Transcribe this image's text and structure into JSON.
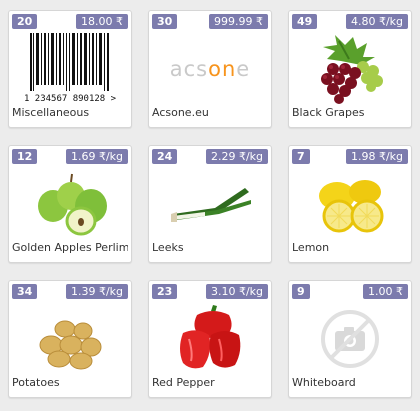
{
  "products": [
    {
      "qty": "20",
      "price": "18.00 ₹",
      "name": "Miscellaneous",
      "icon": "barcode-image"
    },
    {
      "qty": "30",
      "price": "999.99 ₹",
      "name": "Acsone.eu",
      "icon": "acsone-logo",
      "logo_text": {
        "a": "acs",
        "b": "on",
        "c": "e"
      }
    },
    {
      "qty": "49",
      "price": "4.80 ₹/kg",
      "name": "Black Grapes",
      "icon": "grapes-image"
    },
    {
      "qty": "12",
      "price": "1.69 ₹/kg",
      "name": "Golden Apples Perlim",
      "icon": "apples-image"
    },
    {
      "qty": "24",
      "price": "2.29 ₹/kg",
      "name": "Leeks",
      "icon": "leeks-image"
    },
    {
      "qty": "7",
      "price": "1.98 ₹/kg",
      "name": "Lemon",
      "icon": "lemon-image"
    },
    {
      "qty": "34",
      "price": "1.39 ₹/kg",
      "name": "Potatoes",
      "icon": "potatoes-image"
    },
    {
      "qty": "23",
      "price": "3.10 ₹/kg",
      "name": "Red Pepper",
      "icon": "red-pepper-image"
    },
    {
      "qty": "9",
      "price": "1.00 ₹",
      "name": "Whiteboard",
      "icon": "no-image-placeholder"
    }
  ],
  "barcode_digits": "1  234567  890128  >",
  "colors": {
    "badge": "#7c7bad",
    "background": "#ececec",
    "card": "#ffffff",
    "acsone_orange": "#f7941d"
  }
}
